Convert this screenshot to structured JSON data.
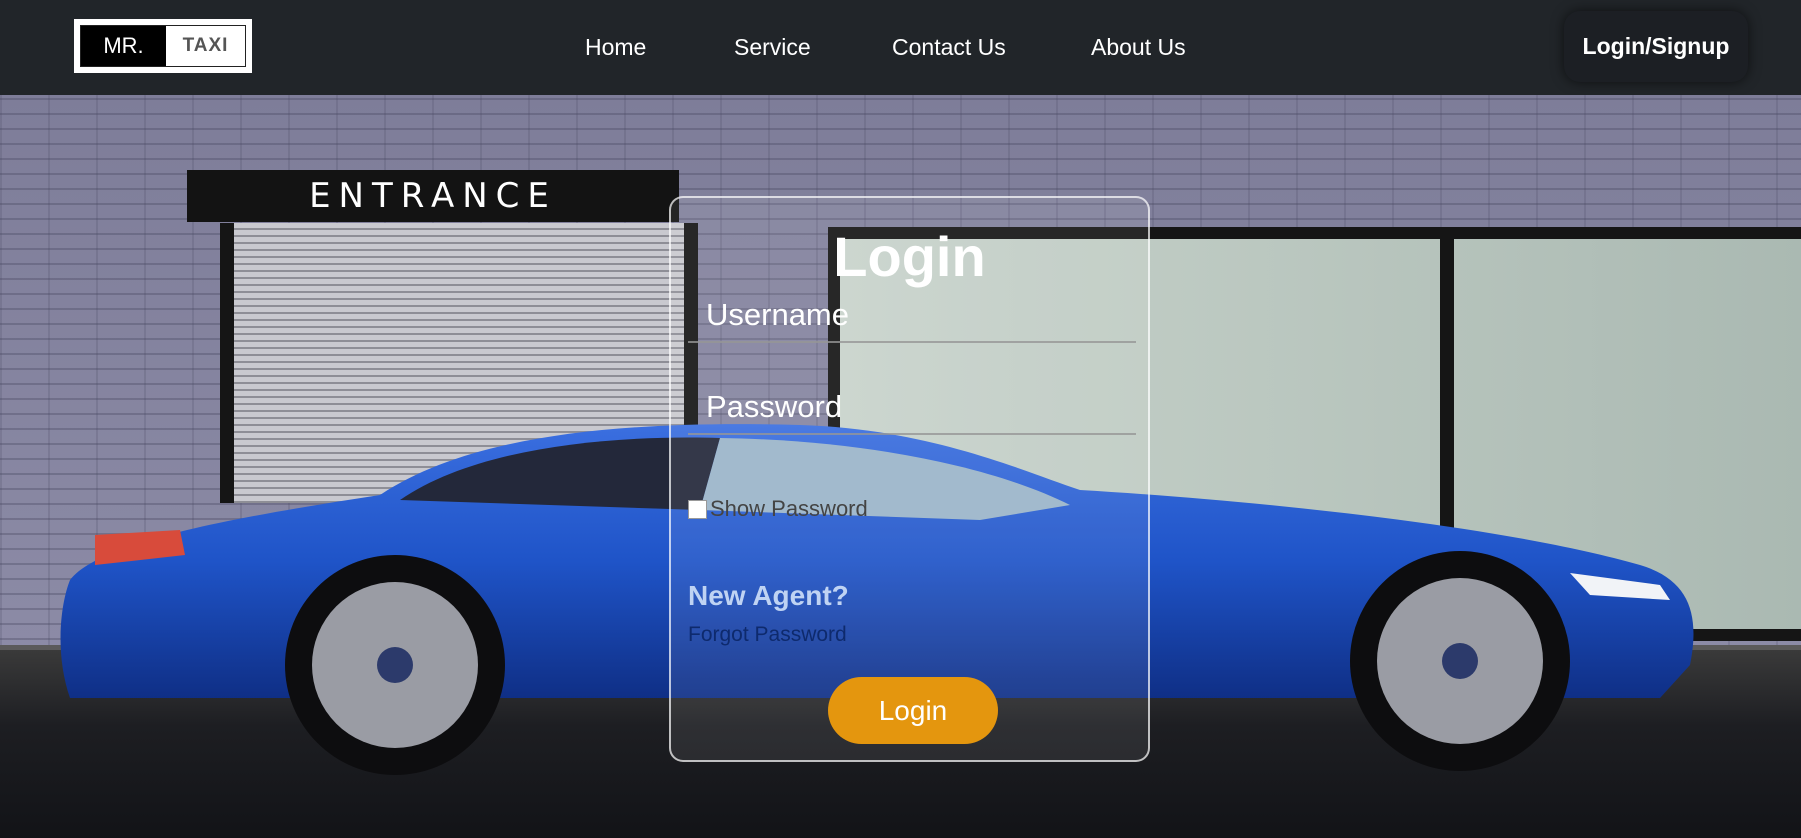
{
  "header": {
    "logo_left": "MR.",
    "logo_right": "TAXI",
    "nav": [
      "Home",
      "Service",
      "Contact Us",
      "About Us"
    ],
    "auth_label": "Login/Signup"
  },
  "background": {
    "sign_text": "ENTRANCE"
  },
  "login": {
    "title": "Login",
    "username_placeholder": "Username",
    "password_placeholder": "Password",
    "show_password_label": "Show Password",
    "new_agent": "New Agent?",
    "forgot_password": "Forgot Password",
    "submit_label": "Login"
  },
  "colors": {
    "navbar": "#212529",
    "button": "#e4960e",
    "car": "#1f54c8"
  }
}
